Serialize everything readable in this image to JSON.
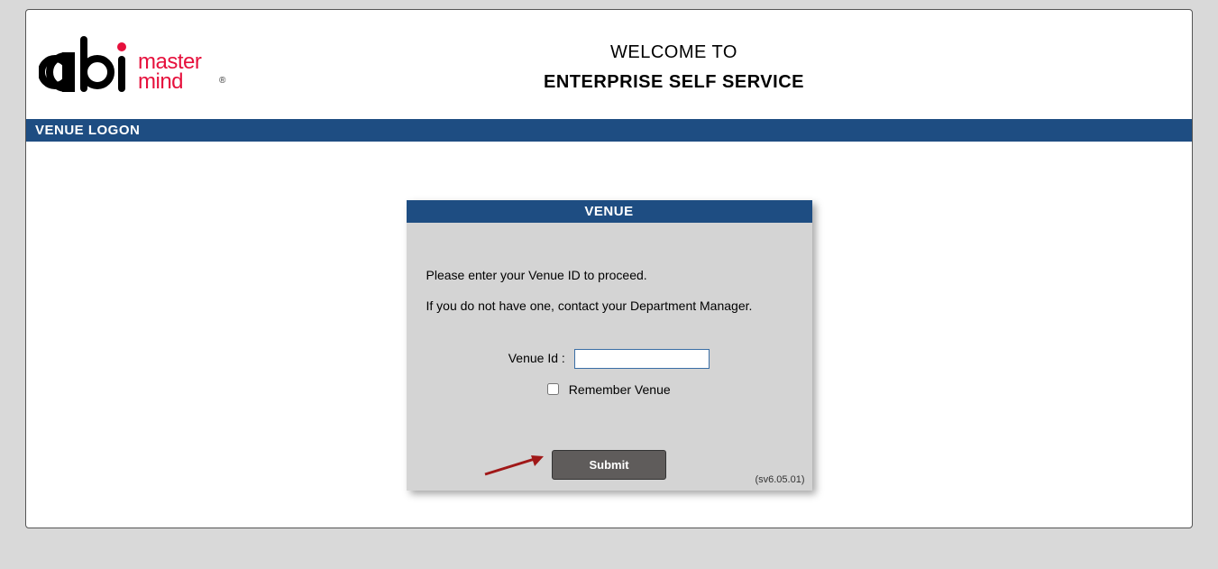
{
  "logo": {
    "text_main": "abi",
    "text_sub1": "master",
    "text_sub2": "mind"
  },
  "header": {
    "welcome_line1": "WELCOME TO",
    "welcome_line2": "ENTERPRISE SELF SERVICE"
  },
  "section_bar": "VENUE LOGON",
  "panel": {
    "title": "VENUE",
    "instruction1": "Please enter your Venue ID to proceed.",
    "instruction2": "If you do not have one, contact your Department Manager.",
    "venue_id_label": "Venue Id :",
    "venue_id_value": "",
    "remember_label": "Remember Venue",
    "submit_label": "Submit",
    "version": "(sv6.05.01)"
  }
}
